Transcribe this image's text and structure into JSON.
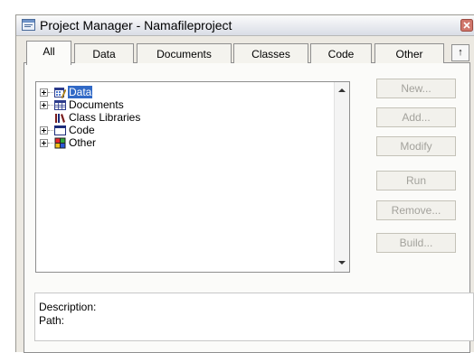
{
  "window": {
    "title": "Project Manager - Namafileproject"
  },
  "tabs": [
    {
      "label": "All"
    },
    {
      "label": "Data"
    },
    {
      "label": "Documents"
    },
    {
      "label": "Classes"
    },
    {
      "label": "Code"
    },
    {
      "label": "Other"
    }
  ],
  "tab_scroll_glyph": "↑",
  "tree": {
    "items": [
      {
        "label": "Data",
        "icon": "data-icon",
        "expandable": true,
        "selected": true
      },
      {
        "label": "Documents",
        "icon": "documents-icon",
        "expandable": true
      },
      {
        "label": "Class Libraries",
        "icon": "class-libraries-icon",
        "expandable": false
      },
      {
        "label": "Code",
        "icon": "code-icon",
        "expandable": true
      },
      {
        "label": "Other",
        "icon": "other-icon",
        "expandable": true
      }
    ]
  },
  "buttons": [
    {
      "label": "New...",
      "enabled": false
    },
    {
      "label": "Add...",
      "enabled": false
    },
    {
      "label": "Modify",
      "enabled": false
    },
    {
      "label": "Run",
      "enabled": false
    },
    {
      "label": "Remove...",
      "enabled": false
    },
    {
      "label": "Build...",
      "enabled": false
    }
  ],
  "info": {
    "description_label": "Description:",
    "path_label": "Path:"
  },
  "colors": {
    "selection": "#3169c6",
    "disabled_text": "#a3a29c"
  }
}
